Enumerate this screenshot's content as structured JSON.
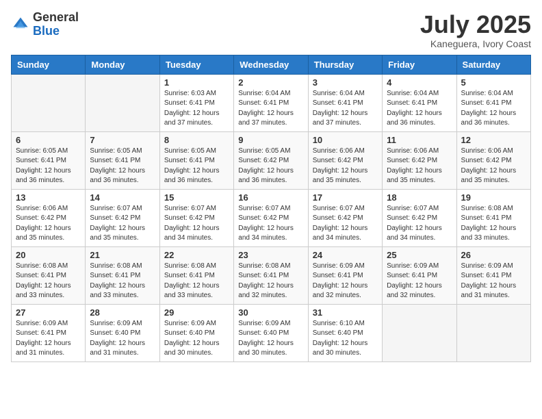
{
  "header": {
    "logo_general": "General",
    "logo_blue": "Blue",
    "month_title": "July 2025",
    "location": "Kaneguera, Ivory Coast"
  },
  "days_of_week": [
    "Sunday",
    "Monday",
    "Tuesday",
    "Wednesday",
    "Thursday",
    "Friday",
    "Saturday"
  ],
  "weeks": [
    [
      {
        "day": "",
        "sunrise": "",
        "sunset": "",
        "daylight": ""
      },
      {
        "day": "",
        "sunrise": "",
        "sunset": "",
        "daylight": ""
      },
      {
        "day": "1",
        "sunrise": "Sunrise: 6:03 AM",
        "sunset": "Sunset: 6:41 PM",
        "daylight": "Daylight: 12 hours and 37 minutes."
      },
      {
        "day": "2",
        "sunrise": "Sunrise: 6:04 AM",
        "sunset": "Sunset: 6:41 PM",
        "daylight": "Daylight: 12 hours and 37 minutes."
      },
      {
        "day": "3",
        "sunrise": "Sunrise: 6:04 AM",
        "sunset": "Sunset: 6:41 PM",
        "daylight": "Daylight: 12 hours and 37 minutes."
      },
      {
        "day": "4",
        "sunrise": "Sunrise: 6:04 AM",
        "sunset": "Sunset: 6:41 PM",
        "daylight": "Daylight: 12 hours and 36 minutes."
      },
      {
        "day": "5",
        "sunrise": "Sunrise: 6:04 AM",
        "sunset": "Sunset: 6:41 PM",
        "daylight": "Daylight: 12 hours and 36 minutes."
      }
    ],
    [
      {
        "day": "6",
        "sunrise": "Sunrise: 6:05 AM",
        "sunset": "Sunset: 6:41 PM",
        "daylight": "Daylight: 12 hours and 36 minutes."
      },
      {
        "day": "7",
        "sunrise": "Sunrise: 6:05 AM",
        "sunset": "Sunset: 6:41 PM",
        "daylight": "Daylight: 12 hours and 36 minutes."
      },
      {
        "day": "8",
        "sunrise": "Sunrise: 6:05 AM",
        "sunset": "Sunset: 6:41 PM",
        "daylight": "Daylight: 12 hours and 36 minutes."
      },
      {
        "day": "9",
        "sunrise": "Sunrise: 6:05 AM",
        "sunset": "Sunset: 6:42 PM",
        "daylight": "Daylight: 12 hours and 36 minutes."
      },
      {
        "day": "10",
        "sunrise": "Sunrise: 6:06 AM",
        "sunset": "Sunset: 6:42 PM",
        "daylight": "Daylight: 12 hours and 35 minutes."
      },
      {
        "day": "11",
        "sunrise": "Sunrise: 6:06 AM",
        "sunset": "Sunset: 6:42 PM",
        "daylight": "Daylight: 12 hours and 35 minutes."
      },
      {
        "day": "12",
        "sunrise": "Sunrise: 6:06 AM",
        "sunset": "Sunset: 6:42 PM",
        "daylight": "Daylight: 12 hours and 35 minutes."
      }
    ],
    [
      {
        "day": "13",
        "sunrise": "Sunrise: 6:06 AM",
        "sunset": "Sunset: 6:42 PM",
        "daylight": "Daylight: 12 hours and 35 minutes."
      },
      {
        "day": "14",
        "sunrise": "Sunrise: 6:07 AM",
        "sunset": "Sunset: 6:42 PM",
        "daylight": "Daylight: 12 hours and 35 minutes."
      },
      {
        "day": "15",
        "sunrise": "Sunrise: 6:07 AM",
        "sunset": "Sunset: 6:42 PM",
        "daylight": "Daylight: 12 hours and 34 minutes."
      },
      {
        "day": "16",
        "sunrise": "Sunrise: 6:07 AM",
        "sunset": "Sunset: 6:42 PM",
        "daylight": "Daylight: 12 hours and 34 minutes."
      },
      {
        "day": "17",
        "sunrise": "Sunrise: 6:07 AM",
        "sunset": "Sunset: 6:42 PM",
        "daylight": "Daylight: 12 hours and 34 minutes."
      },
      {
        "day": "18",
        "sunrise": "Sunrise: 6:07 AM",
        "sunset": "Sunset: 6:42 PM",
        "daylight": "Daylight: 12 hours and 34 minutes."
      },
      {
        "day": "19",
        "sunrise": "Sunrise: 6:08 AM",
        "sunset": "Sunset: 6:41 PM",
        "daylight": "Daylight: 12 hours and 33 minutes."
      }
    ],
    [
      {
        "day": "20",
        "sunrise": "Sunrise: 6:08 AM",
        "sunset": "Sunset: 6:41 PM",
        "daylight": "Daylight: 12 hours and 33 minutes."
      },
      {
        "day": "21",
        "sunrise": "Sunrise: 6:08 AM",
        "sunset": "Sunset: 6:41 PM",
        "daylight": "Daylight: 12 hours and 33 minutes."
      },
      {
        "day": "22",
        "sunrise": "Sunrise: 6:08 AM",
        "sunset": "Sunset: 6:41 PM",
        "daylight": "Daylight: 12 hours and 33 minutes."
      },
      {
        "day": "23",
        "sunrise": "Sunrise: 6:08 AM",
        "sunset": "Sunset: 6:41 PM",
        "daylight": "Daylight: 12 hours and 32 minutes."
      },
      {
        "day": "24",
        "sunrise": "Sunrise: 6:09 AM",
        "sunset": "Sunset: 6:41 PM",
        "daylight": "Daylight: 12 hours and 32 minutes."
      },
      {
        "day": "25",
        "sunrise": "Sunrise: 6:09 AM",
        "sunset": "Sunset: 6:41 PM",
        "daylight": "Daylight: 12 hours and 32 minutes."
      },
      {
        "day": "26",
        "sunrise": "Sunrise: 6:09 AM",
        "sunset": "Sunset: 6:41 PM",
        "daylight": "Daylight: 12 hours and 31 minutes."
      }
    ],
    [
      {
        "day": "27",
        "sunrise": "Sunrise: 6:09 AM",
        "sunset": "Sunset: 6:41 PM",
        "daylight": "Daylight: 12 hours and 31 minutes."
      },
      {
        "day": "28",
        "sunrise": "Sunrise: 6:09 AM",
        "sunset": "Sunset: 6:40 PM",
        "daylight": "Daylight: 12 hours and 31 minutes."
      },
      {
        "day": "29",
        "sunrise": "Sunrise: 6:09 AM",
        "sunset": "Sunset: 6:40 PM",
        "daylight": "Daylight: 12 hours and 30 minutes."
      },
      {
        "day": "30",
        "sunrise": "Sunrise: 6:09 AM",
        "sunset": "Sunset: 6:40 PM",
        "daylight": "Daylight: 12 hours and 30 minutes."
      },
      {
        "day": "31",
        "sunrise": "Sunrise: 6:10 AM",
        "sunset": "Sunset: 6:40 PM",
        "daylight": "Daylight: 12 hours and 30 minutes."
      },
      {
        "day": "",
        "sunrise": "",
        "sunset": "",
        "daylight": ""
      },
      {
        "day": "",
        "sunrise": "",
        "sunset": "",
        "daylight": ""
      }
    ]
  ]
}
